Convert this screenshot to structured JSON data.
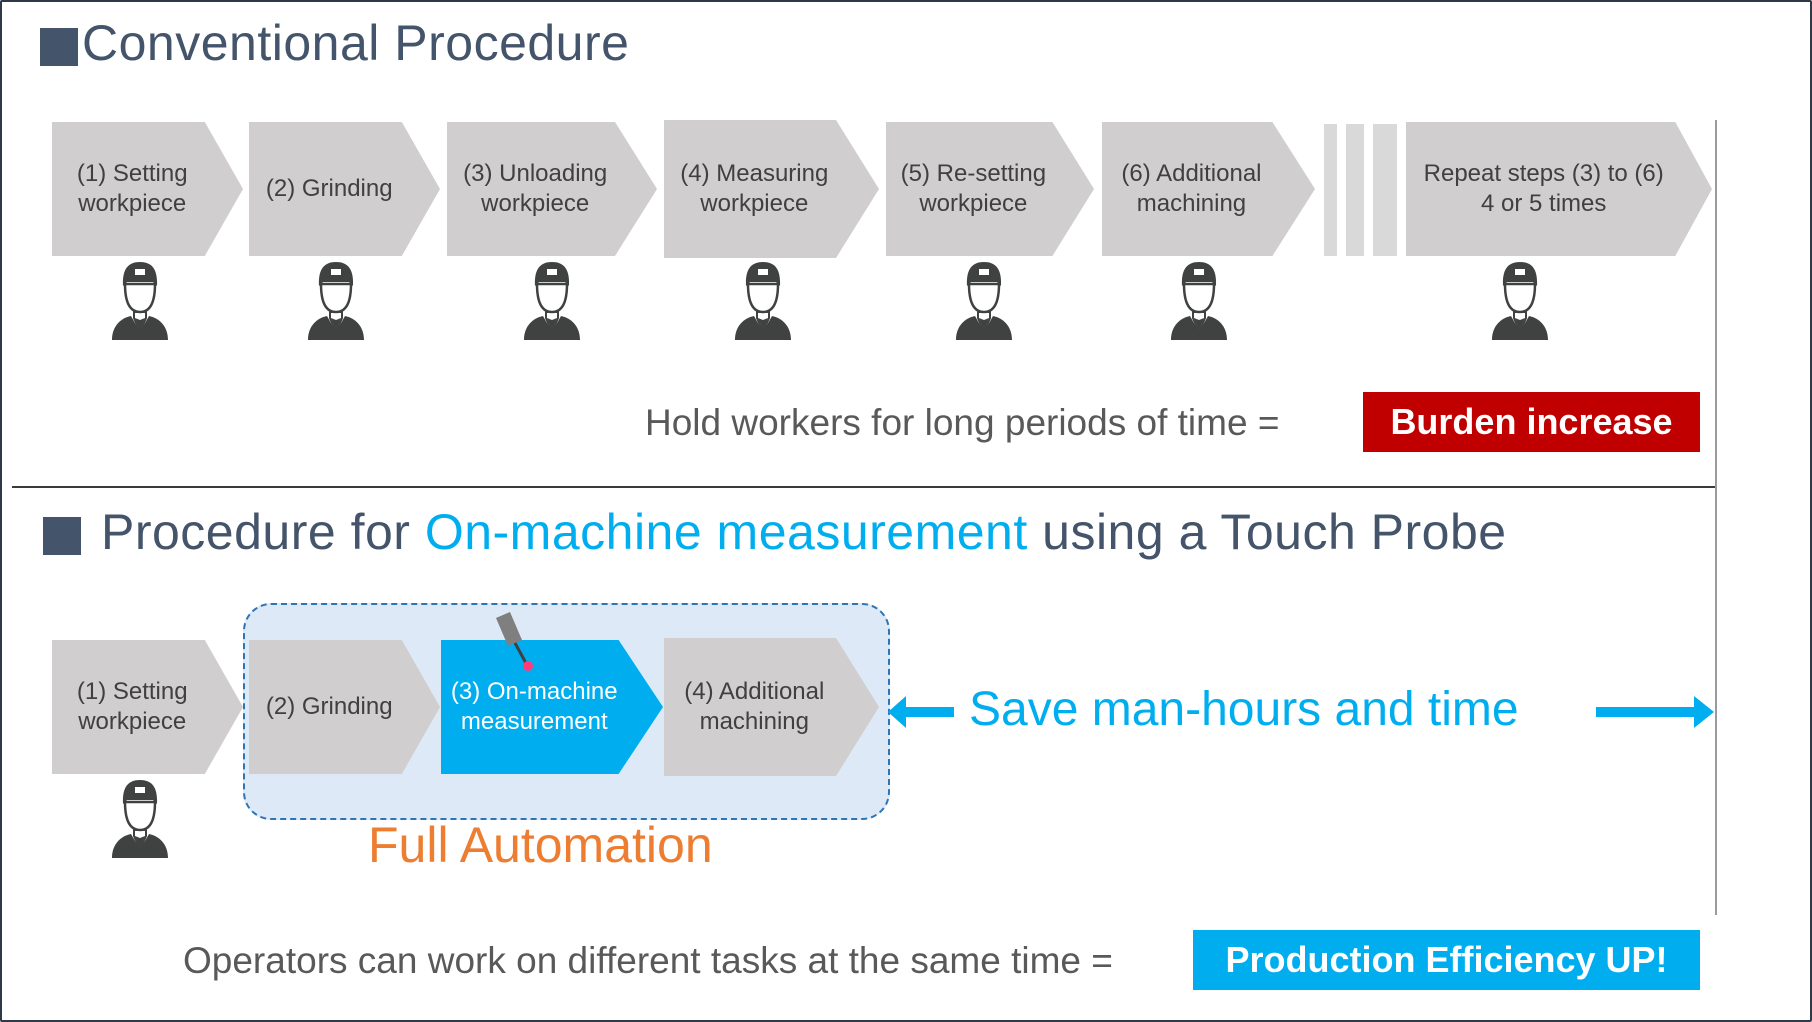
{
  "colors": {
    "heading": "#44546a",
    "accent_blue": "#00aeef",
    "burden_red": "#c00000",
    "automation_orange": "#ed7d31",
    "step_gray": "#d0cecf",
    "frame": "#2f3a48"
  },
  "conventional": {
    "title": "Conventional Procedure",
    "steps": [
      {
        "label": "(1) Setting\nworkpiece"
      },
      {
        "label": "(2) Grinding"
      },
      {
        "label": "(3) Unloading\nworkpiece"
      },
      {
        "label": "(4) Measuring\nworkpiece"
      },
      {
        "label": "(5) Re-setting\nworkpiece"
      },
      {
        "label": "(6) Additional\nmachining"
      },
      {
        "label": "Repeat steps (3) to (6)\n4 or 5 times"
      }
    ],
    "statement": "Hold workers for long periods of time =",
    "result_badge": "Burden increase"
  },
  "touch_probe": {
    "title_prefix": "Procedure for ",
    "title_highlight": "On-machine measurement",
    "title_suffix": " using a Touch Probe",
    "steps": [
      {
        "label": "(1) Setting\nworkpiece"
      },
      {
        "label": "(2) Grinding"
      },
      {
        "label": "(3) On-machine\nmeasurement"
      },
      {
        "label": "(4) Additional\nmachining"
      }
    ],
    "automation_label": "Full Automation",
    "save_label": "Save man-hours and time",
    "statement": "Operators can work on different tasks at the same time =",
    "result_badge": "Production Efficiency UP!"
  }
}
